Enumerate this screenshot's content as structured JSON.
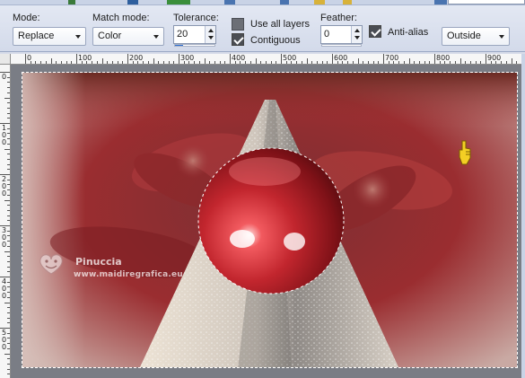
{
  "options": {
    "mode_label": "Mode:",
    "mode_value": "Replace",
    "match_mode_label": "Match mode:",
    "match_mode_value": "Color",
    "tolerance_label": "Tolerance:",
    "tolerance_value": "20",
    "tolerance_fraction": 0.2,
    "use_all_layers_label": "Use all layers",
    "use_all_layers_checked": false,
    "contiguous_label": "Contiguous",
    "contiguous_checked": true,
    "feather_label": "Feather:",
    "feather_value": "0",
    "anti_alias_label": "Anti-alias",
    "anti_alias_checked": true,
    "fill_mode_value": "Outside"
  },
  "ruler": {
    "top_labels": [
      "0",
      "100",
      "200",
      "300",
      "400",
      "500",
      "600",
      "700",
      "800",
      "900"
    ],
    "left_labels": [
      "0",
      "100",
      "200",
      "300",
      "400",
      "500"
    ]
  },
  "watermark": {
    "name": "Pinuccia",
    "url": "www.maidiregrafica.eu"
  },
  "icons": {
    "cursor": "pointing-hand-icon",
    "watermark_logo": "heart-smiley-icon"
  },
  "colors": {
    "toolbar_bg": "#d6dbe9",
    "image_red": "#9b2a2e",
    "sphere_red": "#c2262e",
    "cone_silver": "#d9d2c8",
    "selection_marquee": "#ffffff"
  }
}
